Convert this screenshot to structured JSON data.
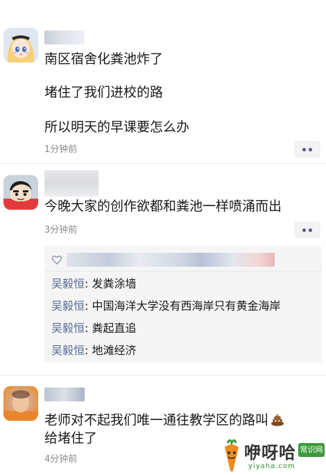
{
  "posts": [
    {
      "avatar": "anime-girl-avatar",
      "lines": [
        "南区宿舍化粪池炸了",
        "堵住了我们进校的路",
        "所以明天的早课要怎么办"
      ],
      "time": "1分钟前"
    },
    {
      "avatar": "cartoon-boy-avatar",
      "lines": [
        "今晚大家的创作欲都和粪池一样喷涌而出"
      ],
      "time": "3分钟前",
      "comments": [
        {
          "author": "吴毅恒",
          "separator": ":",
          "text": "发粪涂墙"
        },
        {
          "author": "吴毅恒",
          "separator": ":",
          "text": "中国海洋大学没有西海岸只有黄金海岸"
        },
        {
          "author": "吴毅恒",
          "separator": ":",
          "text": "粪起直追"
        },
        {
          "author": "吴毅恒",
          "separator": ":",
          "text": "地滩经济"
        }
      ]
    },
    {
      "avatar": "blurred-photo-avatar",
      "lines": [
        "老师对不起我们唯一通往教学区的路叫",
        "给堵住了"
      ],
      "time": "4分钟前"
    }
  ],
  "watermark": {
    "brand": "咿呀哈",
    "badge": "常识网",
    "url": "yiyaha.com"
  },
  "colors": {
    "link": "#576b95",
    "time": "#8a8a8a",
    "comment_bg": "#f5f5f5",
    "more_button_bg": "#f2f2f2"
  }
}
